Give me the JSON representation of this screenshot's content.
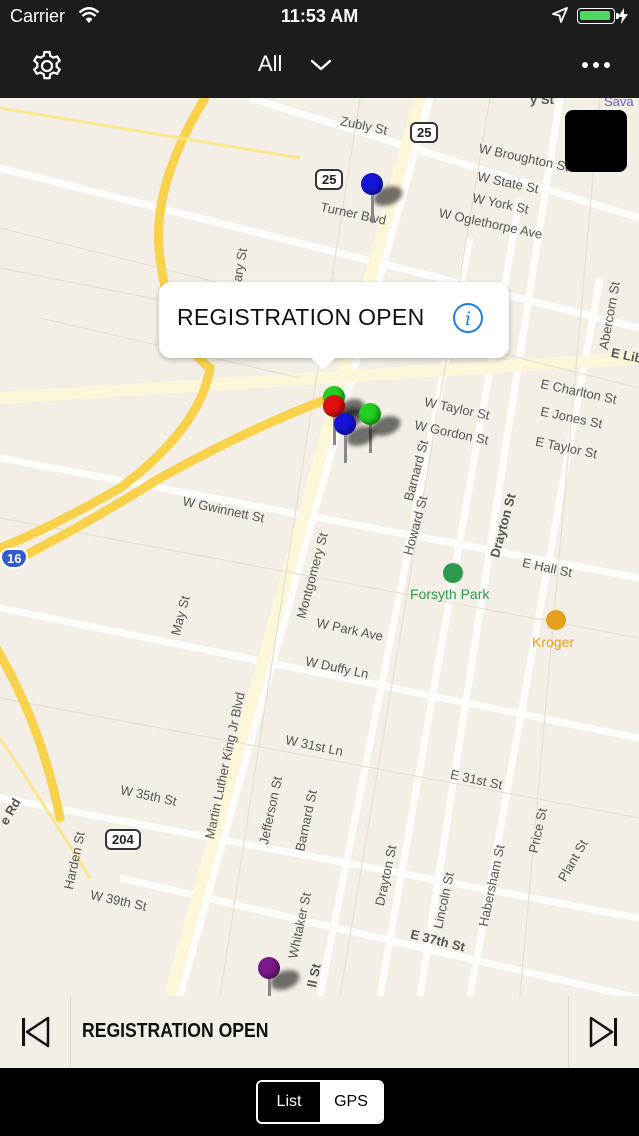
{
  "status_bar": {
    "carrier": "Carrier",
    "time": "11:53 AM"
  },
  "nav": {
    "filter_label": "All"
  },
  "map": {
    "street_labels": [
      "Zubly St",
      "W Broughton St",
      "W State St",
      "W York St",
      "Turner Blvd",
      "W Oglethorpe Ave",
      "W Taylor St",
      "W Gordon St",
      "E Charlton St",
      "E Jones St",
      "E Taylor St",
      "W Gwinnett St",
      "Barnard St",
      "Howard St",
      "Drayton St",
      "E Hall St",
      "W Park Ave",
      "May St",
      "Montgomery St",
      "W Duffy Ln",
      "W 31st Ln",
      "E 31st St",
      "W 35th St",
      "Martin Luther King Jr Blvd",
      "Jefferson St",
      "Barnard St",
      "Harden St",
      "W 39th St",
      "Whitaker St",
      "Drayton St",
      "Lincoln St",
      "Habersham St",
      "Price St",
      "Plant St",
      "E 37th St",
      "Abercorn St",
      "E Lib",
      "undary St",
      "e Rd",
      "ll St",
      "y St",
      "Sava"
    ],
    "route_shields": [
      "25",
      "25",
      "16",
      "204"
    ],
    "park_label": "Forsyth Park",
    "store_label": "Kroger",
    "callout": {
      "title": "REGISTRATION OPEN"
    }
  },
  "info_bar": {
    "title": "REGISTRATION OPEN"
  },
  "bottom": {
    "list_label": "List",
    "gps_label": "GPS",
    "selected": "GPS"
  },
  "colors": {
    "bars": "#1c1c1c",
    "map_bg": "#f3efe6",
    "highway": "#f7d24a",
    "info_blue": "#1a7ee8",
    "pin_blue": "#1515d8",
    "pin_red": "#e01010",
    "pin_green": "#22d022",
    "pin_purple": "#7a1a8a"
  }
}
